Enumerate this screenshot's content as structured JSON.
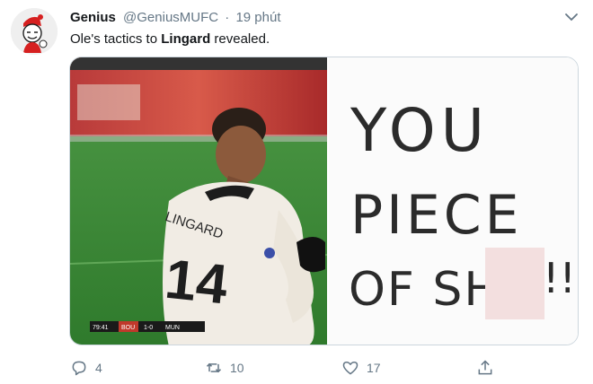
{
  "tweet": {
    "author_name": "Genius",
    "author_handle": "@GeniusMUFC",
    "separator": "·",
    "time": "19 phút",
    "text_before": "Ole's tactics to ",
    "text_bold": "Lingard",
    "text_after": " revealed.",
    "image": {
      "left": {
        "jersey_name": "LINGARD",
        "jersey_number": "14",
        "scoreboard_time": "79:41",
        "scoreboard_home": "BOU",
        "scoreboard_score": "1-0",
        "scoreboard_away": "MUN"
      },
      "right": {
        "line1": "YOU",
        "line2": "PIECE",
        "line3": "OF SHI",
        "line3_end": "!!"
      }
    }
  },
  "actions": {
    "replies": "4",
    "retweets": "10",
    "likes": "17"
  },
  "icons": {
    "reply": "comment-icon",
    "retweet": "retweet-icon",
    "like": "heart-icon",
    "share": "share-icon",
    "more": "chevron-down-icon"
  },
  "colors": {
    "text": "#14171a",
    "muted": "#657786",
    "pitch": "#3f8a3a",
    "jersey": "#f1ece4"
  }
}
